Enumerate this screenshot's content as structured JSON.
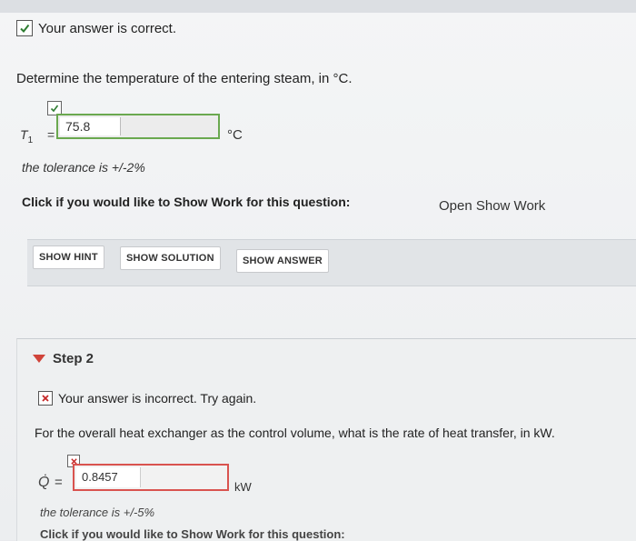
{
  "status": {
    "correct_text": "Your answer is correct."
  },
  "question1": {
    "text": "Determine the temperature of the entering steam, in °C.",
    "variable_label": "T",
    "variable_sub": "1",
    "equals": "=",
    "answer_value": "75.8",
    "unit": "°C",
    "tolerance": "the tolerance is +/-2%",
    "show_work_prompt": "Click if you would like to Show Work for this question:",
    "open_show_work": "Open Show Work"
  },
  "buttons": {
    "show_hint": "SHOW HINT",
    "show_solution": "SHOW SOLUTION",
    "show_answer": "SHOW ANSWER"
  },
  "step2": {
    "label": "Step 2",
    "incorrect_text": "Your answer is incorrect.  Try again.",
    "question": "For the overall heat exchanger as the control volume, what is the rate of heat transfer, in kW.",
    "variable_label": "Q̇",
    "equals": "=",
    "answer_value": "0.8457",
    "unit": "kW",
    "tolerance": "the tolerance is +/-5%",
    "cut_text": "Click if you would like to Show Work for this question:"
  },
  "colors": {
    "correct_green": "#6aa84f",
    "incorrect_red": "#d9534f",
    "step_triangle": "#d0443a"
  },
  "icons": [
    "checkmark-icon",
    "x-icon",
    "disclosure-triangle-icon"
  ]
}
